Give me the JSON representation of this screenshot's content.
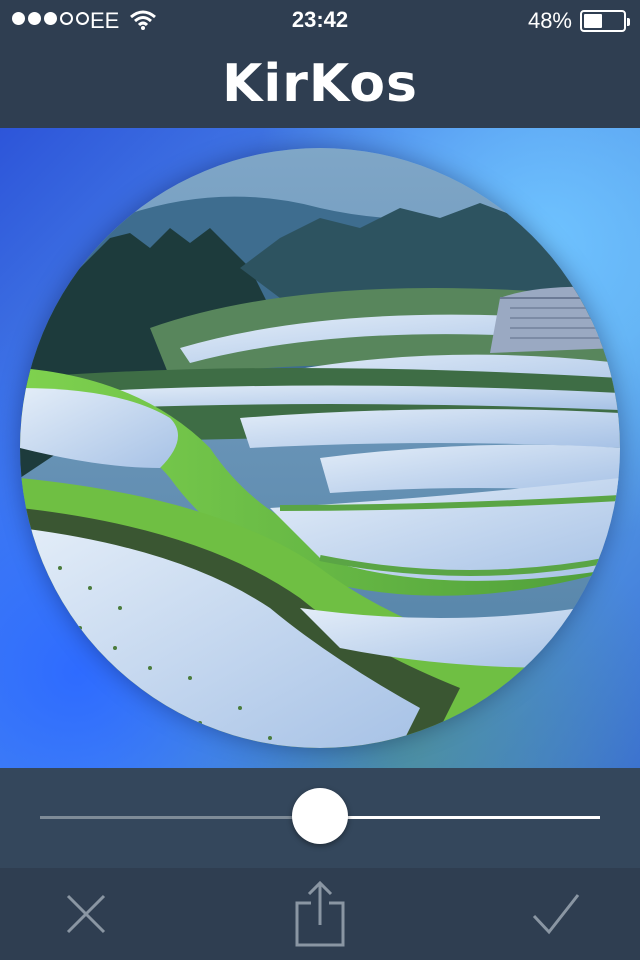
{
  "status_bar": {
    "signal_bars": 5,
    "signal_filled": 3,
    "carrier": "EE",
    "time": "23:42",
    "battery_percent": "48%",
    "battery_level": 0.48,
    "icons": [
      "signal-dots-icon",
      "wifi-icon",
      "battery-icon"
    ]
  },
  "nav": {
    "title": "KirKos"
  },
  "photo": {
    "subject_icon": "terraced-rice-fields-photo"
  },
  "slider": {
    "value": 0.5
  },
  "toolbar": {
    "icons": [
      "close-icon",
      "share-icon",
      "checkmark-icon"
    ]
  },
  "colors": {
    "bar_background": "#2f3e51",
    "slider_background": "#34475c",
    "icon_gray": "#8a96a3"
  }
}
